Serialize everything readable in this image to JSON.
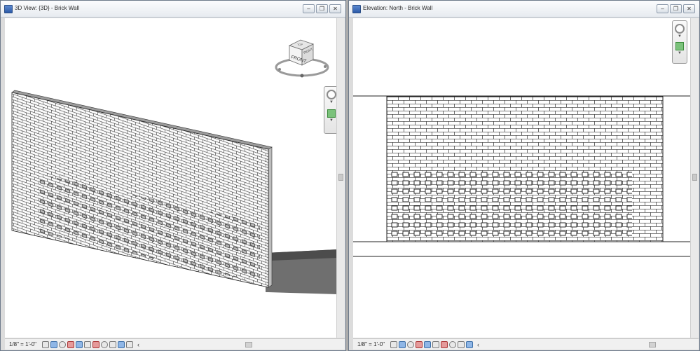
{
  "left_window": {
    "title": "3D View: {3D} - Brick Wall",
    "scale": "1/8\" = 1'-0\"",
    "buttons": {
      "minimize": "–",
      "restore": "❐",
      "close": "✕"
    },
    "viewcube_label": "FRONT",
    "viewcube_side_label": "RIGHT",
    "viewcube_top_label": "TOP"
  },
  "right_window": {
    "title": "Elevation: North - Brick Wall",
    "scale": "1/8\" = 1'-0\"",
    "buttons": {
      "minimize": "–",
      "restore": "❐",
      "close": "✕"
    }
  },
  "icons": [
    "detail-level-icon",
    "visual-style-icon",
    "sun-path-icon",
    "shadows-icon",
    "crop-icon",
    "crop-region-icon",
    "unlock-icon",
    "temporary-hide-icon",
    "reveal-hidden-icon",
    "worksharing-icon",
    "analysis-icon"
  ],
  "colors": {
    "title_gradient_top": "#fbfcfd",
    "frame": "#6d7a8a",
    "viewport": "#ffffff"
  }
}
